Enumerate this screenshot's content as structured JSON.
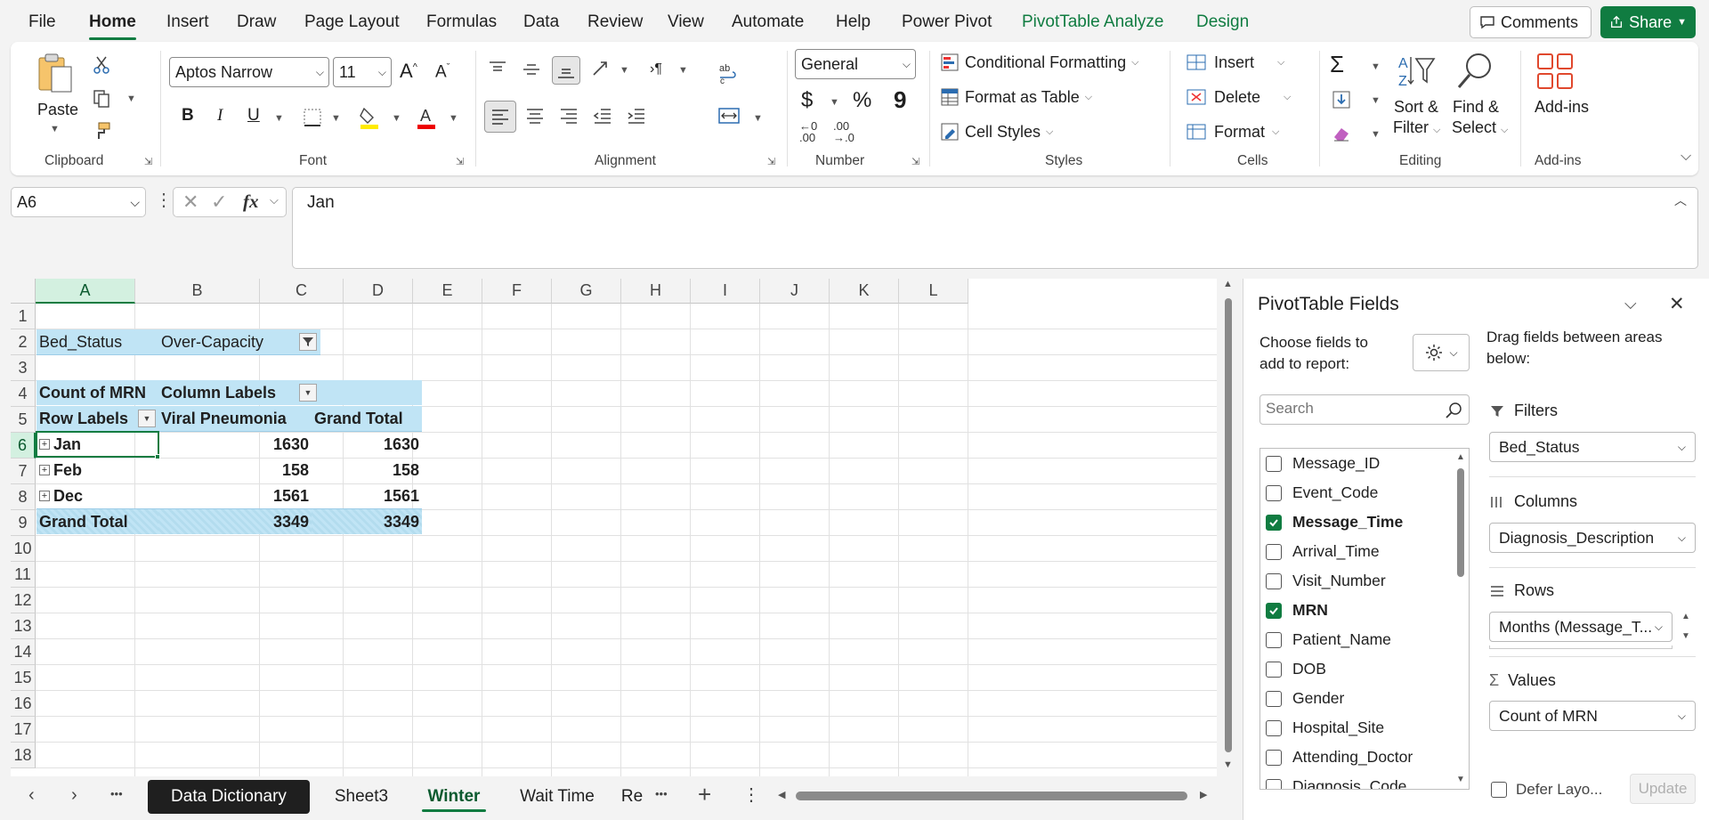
{
  "menu": {
    "items": [
      "File",
      "Home",
      "Insert",
      "Draw",
      "Page Layout",
      "Formulas",
      "Data",
      "Review",
      "View",
      "Automate",
      "Help",
      "Power Pivot",
      "PivotTable Analyze",
      "Design"
    ],
    "comments": "Comments",
    "share": "Share"
  },
  "ribbon": {
    "clipboard": {
      "paste": "Paste",
      "label": "Clipboard"
    },
    "font": {
      "name": "Aptos Narrow",
      "size": "11",
      "label": "Font",
      "bold": "B",
      "italic": "I",
      "underline": "U",
      "grow": "A",
      "shrink": "A"
    },
    "alignment": {
      "label": "Alignment"
    },
    "number": {
      "format": "General",
      "label": "Number",
      "currency": "$",
      "percent": "%",
      "comma": "9",
      "inc_dec_a": "←0",
      "inc_dec_b": ".00",
      "dec_dec_a": ".00",
      "dec_dec_b": "→.0"
    },
    "styles": {
      "conditional": "Conditional Formatting",
      "format_table": "Format as Table",
      "cell_styles": "Cell Styles",
      "label": "Styles"
    },
    "cells": {
      "insert": "Insert",
      "delete": "Delete",
      "format": "Format",
      "label": "Cells"
    },
    "editing": {
      "sort_1": "Sort &",
      "sort_2": "Filter",
      "find_1": "Find &",
      "find_2": "Select",
      "label": "Editing",
      "sum": "Σ"
    },
    "addins": {
      "button": "Add-ins",
      "label": "Add-ins"
    }
  },
  "formula_bar": {
    "name_box": "A6",
    "fx": "fx",
    "content": "Jan"
  },
  "grid": {
    "columns": [
      "A",
      "B",
      "C",
      "D",
      "E",
      "F",
      "G",
      "H",
      "I",
      "J",
      "K",
      "L"
    ],
    "rows": [
      "1",
      "2",
      "3",
      "4",
      "5",
      "6",
      "7",
      "8",
      "9",
      "10",
      "11",
      "12",
      "13",
      "14",
      "15",
      "16",
      "17",
      "18"
    ],
    "selected_col": "A",
    "selected_row": "6"
  },
  "pivot": {
    "filter_field": "Bed_Status",
    "filter_value": "Over-Capacity",
    "values_header": "Count of MRN",
    "column_labels": "Column Labels",
    "row_labels": "Row Labels",
    "col1": "Viral Pneumonia",
    "col2": "Grand Total",
    "rows": [
      {
        "label": "Jan",
        "v1": "1630",
        "v2": "1630"
      },
      {
        "label": "Feb",
        "v1": "158",
        "v2": "158"
      },
      {
        "label": "Dec",
        "v1": "1561",
        "v2": "1561"
      }
    ],
    "grand_total_label": "Grand Total",
    "grand_total_v1": "3349",
    "grand_total_v2": "3349"
  },
  "tabs": {
    "sheets": [
      "Data Dictionary",
      "Sheet3",
      "Winter",
      "Wait Time",
      "Re"
    ],
    "dots": "•••",
    "add": "+"
  },
  "pane": {
    "title": "PivotTable Fields",
    "choose_1": "Choose fields to",
    "choose_2": "add to report:",
    "drag_1": "Drag fields between areas",
    "drag_2": "below:",
    "search_placeholder": "Search",
    "fields": [
      {
        "name": "Message_ID",
        "checked": false
      },
      {
        "name": "Event_Code",
        "checked": false
      },
      {
        "name": "Message_Time",
        "checked": true
      },
      {
        "name": "Arrival_Time",
        "checked": false
      },
      {
        "name": "Visit_Number",
        "checked": false
      },
      {
        "name": "MRN",
        "checked": true
      },
      {
        "name": "Patient_Name",
        "checked": false
      },
      {
        "name": "DOB",
        "checked": false
      },
      {
        "name": "Gender",
        "checked": false
      },
      {
        "name": "Hospital_Site",
        "checked": false
      },
      {
        "name": "Attending_Doctor",
        "checked": false
      },
      {
        "name": "Diagnosis_Code",
        "checked": false
      }
    ],
    "filters_title": "Filters",
    "filters_value": "Bed_Status",
    "columns_title": "Columns",
    "columns_value": "Diagnosis_Description",
    "rows_title": "Rows",
    "rows_value": "Months (Message_T...",
    "values_title": "Values",
    "values_value": "Count of MRN",
    "defer": "Defer Layo...",
    "update": "Update"
  },
  "colors": {
    "accent": "#107c41",
    "pivot_blue": "#c0e4f5"
  }
}
